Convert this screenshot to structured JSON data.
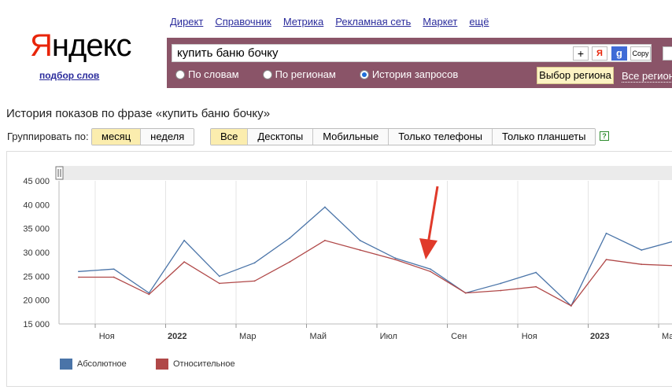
{
  "logo": {
    "first": "Я",
    "rest": "ндекс",
    "subtitle": "подбор слов"
  },
  "nav": [
    "Директ",
    "Справочник",
    "Метрика",
    "Рекламная сеть",
    "Маркет",
    "ещё"
  ],
  "search": {
    "value": "купить баню бочку",
    "btn_plus": "+",
    "btn_ya": "Я",
    "btn_g": "g",
    "btn_copy": "Copy"
  },
  "modes": [
    {
      "label": "По словам",
      "selected": false
    },
    {
      "label": "По регионам",
      "selected": false
    },
    {
      "label": "История запросов",
      "selected": true
    }
  ],
  "region_button": "Выбор региона",
  "region_all": "Все регион",
  "title": "История показов по фразе «купить баню бочку»",
  "group_label": "Группировать по:",
  "group_options": [
    {
      "label": "месяц",
      "active": true
    },
    {
      "label": "неделя",
      "active": false
    }
  ],
  "device_options": [
    {
      "label": "Все",
      "active": true
    },
    {
      "label": "Десктопы",
      "active": false
    },
    {
      "label": "Мобильные",
      "active": false
    },
    {
      "label": "Только телефоны",
      "active": false
    },
    {
      "label": "Только планшеты",
      "active": false
    }
  ],
  "help_icon": "?",
  "colors": {
    "band": "#8a5468",
    "absolute": "#4a74a8",
    "relative": "#b04848",
    "arrow": "#e03a2a"
  },
  "chart_data": {
    "type": "line",
    "ylim": [
      15000,
      45000
    ],
    "y_ticks": [
      "45 000",
      "40 000",
      "35 000",
      "30 000",
      "25 000",
      "20 000",
      "15 000"
    ],
    "x_ticks": [
      {
        "label": "Ноя",
        "bold": false
      },
      {
        "label": "2022",
        "bold": true
      },
      {
        "label": "Мар",
        "bold": false
      },
      {
        "label": "Май",
        "bold": false
      },
      {
        "label": "Июл",
        "bold": false
      },
      {
        "label": "Сен",
        "bold": false
      },
      {
        "label": "Ноя",
        "bold": false
      },
      {
        "label": "2023",
        "bold": true
      },
      {
        "label": "Мар",
        "bold": false
      }
    ],
    "series": [
      {
        "name": "Абсолютное",
        "values": [
          26000,
          26500,
          21500,
          32500,
          25000,
          27800,
          33000,
          39500,
          32500,
          28800,
          26500,
          21500,
          23500,
          25800,
          18800,
          34000,
          30500,
          32500
        ]
      },
      {
        "name": "Относительное",
        "values": [
          24800,
          24800,
          21200,
          28000,
          23500,
          24000,
          28000,
          32500,
          30500,
          28500,
          26000,
          21500,
          22000,
          22800,
          18800,
          28500,
          27500,
          27200
        ]
      }
    ]
  }
}
